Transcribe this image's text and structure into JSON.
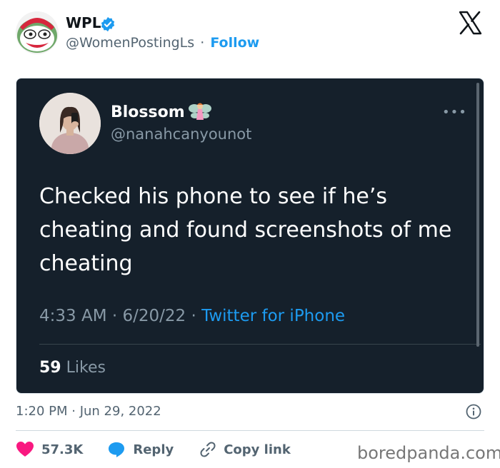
{
  "author": {
    "name": "WPL",
    "handle": "@WomenPostingLs",
    "separator": "·",
    "follow_label": "Follow"
  },
  "embedded_tweet": {
    "name": "Blossom",
    "handle": "@nanahcanyounot",
    "more_label": "•••",
    "text": "Checked his phone to see if he’s cheating and found screenshots of me cheating",
    "time": "4:33 AM",
    "date": "6/20/22",
    "separator": "·",
    "source": "Twitter for iPhone",
    "likes_count": "59",
    "likes_label": "Likes"
  },
  "footer": {
    "timestamp": "1:20 PM · Jun 29, 2022",
    "likes": "57.3K",
    "reply_label": "Reply",
    "copy_link_label": "Copy link",
    "watermark": "boredpanda.com"
  },
  "colors": {
    "accent": "#1d9bf0",
    "heart": "#f91880",
    "card_bg": "#15202b"
  },
  "icons": [
    "verified-badge-icon",
    "x-logo-icon",
    "fairy-emoji-icon",
    "info-icon",
    "heart-icon",
    "reply-icon",
    "link-icon"
  ]
}
